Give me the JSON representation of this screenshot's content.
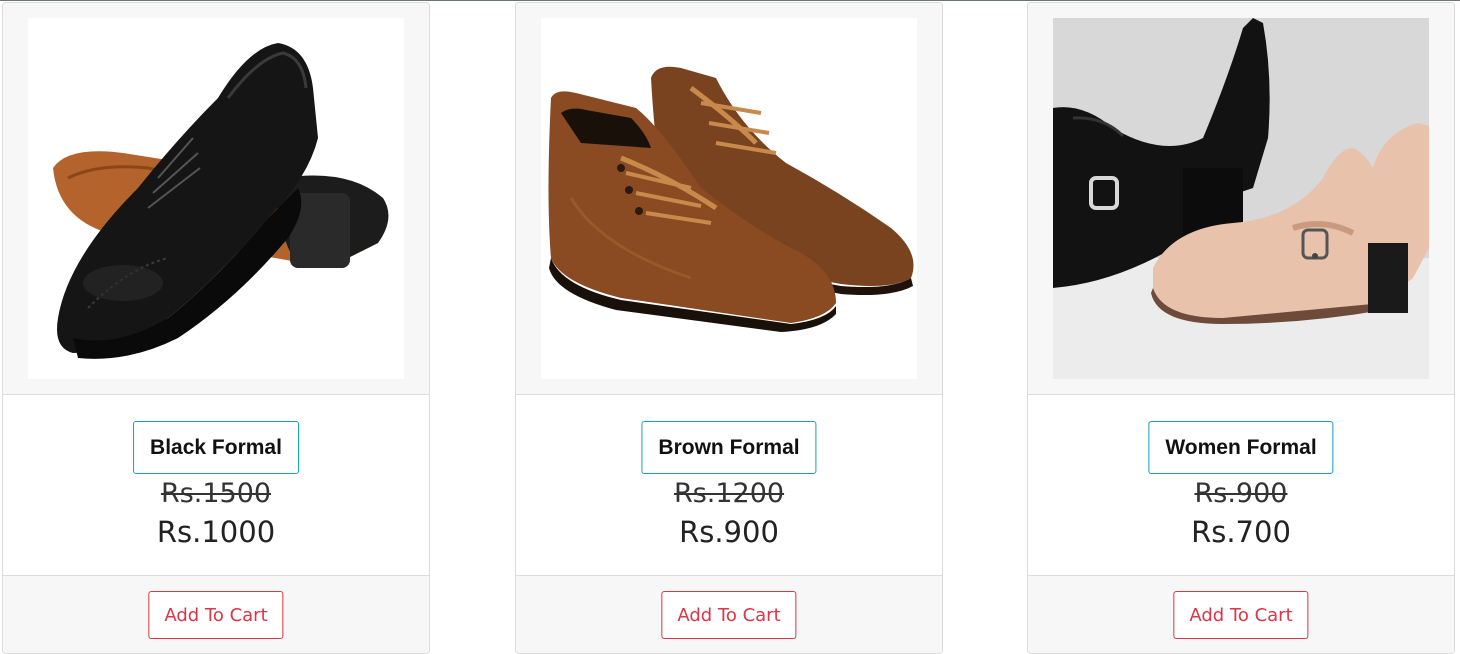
{
  "colors": {
    "name_border": "#17a2b8",
    "cart_accent": "#dc3545",
    "card_border": "#dcdcdc",
    "panel_bg": "#f7f7f7"
  },
  "products": [
    {
      "name": "Black Formal",
      "old_price": "Rs.1500",
      "price": "Rs.1000",
      "cart_label": "Add To Cart",
      "image": "black-oxford-shoes"
    },
    {
      "name": "Brown Formal",
      "old_price": "Rs.1200",
      "price": "Rs.900",
      "cart_label": "Add To Cart",
      "image": "brown-ankle-boots"
    },
    {
      "name": "Women Formal",
      "old_price": "Rs.900",
      "price": "Rs.700",
      "cart_label": "Add To Cart",
      "image": "women-heeled-loafers"
    }
  ]
}
